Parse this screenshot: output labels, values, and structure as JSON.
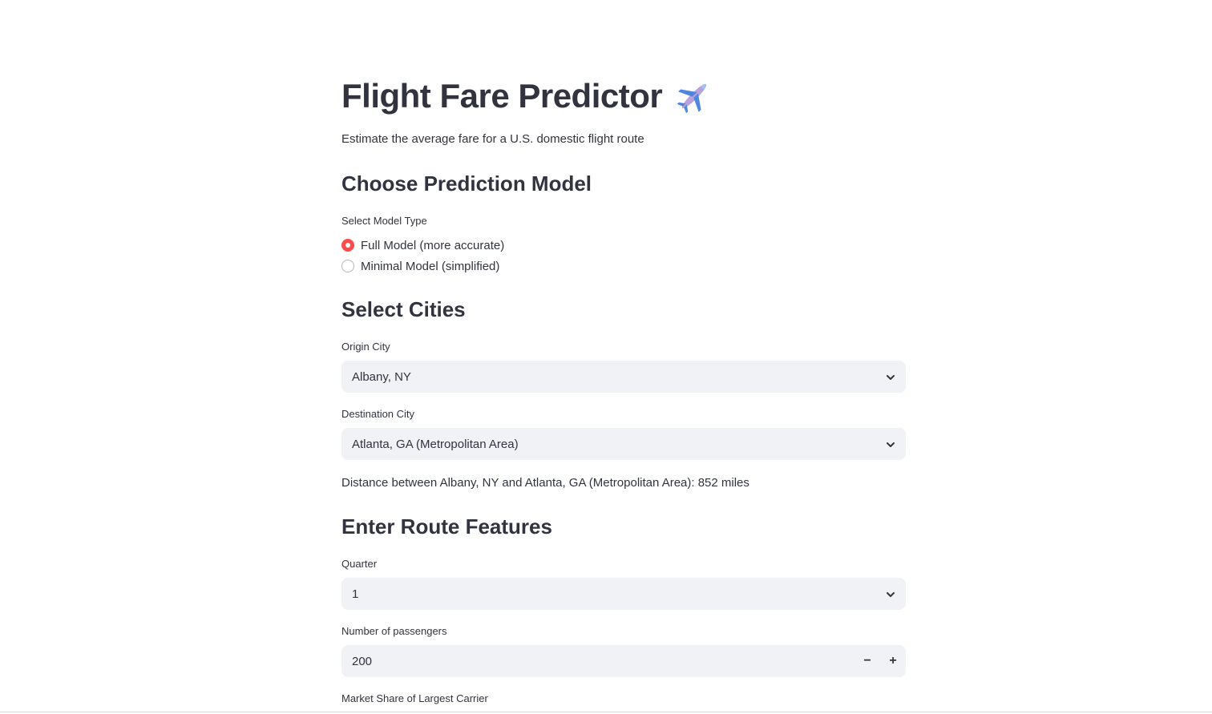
{
  "header": {
    "title": "Flight Fare Predictor",
    "subtitle": "Estimate the average fare for a U.S. domestic flight route"
  },
  "model_section": {
    "heading": "Choose Prediction Model",
    "radio_label": "Select Model Type",
    "options": [
      {
        "label": "Full Model (more accurate)",
        "selected": true
      },
      {
        "label": "Minimal Model (simplified)",
        "selected": false
      }
    ]
  },
  "cities_section": {
    "heading": "Select Cities",
    "origin_label": "Origin City",
    "origin_value": "Albany, NY",
    "destination_label": "Destination City",
    "destination_value": "Atlanta, GA (Metropolitan Area)",
    "distance_text": "Distance between Albany, NY and Atlanta, GA (Metropolitan Area): 852 miles"
  },
  "route_section": {
    "heading": "Enter Route Features",
    "quarter_label": "Quarter",
    "quarter_value": "1",
    "passengers_label": "Number of passengers",
    "passengers_value": "200",
    "decrement_symbol": "−",
    "increment_symbol": "+",
    "market_share_label": "Market Share of Largest Carrier"
  },
  "colors": {
    "accent": "#ff4b4b",
    "input_bg": "#f0f2f6",
    "text": "#31333f"
  },
  "icons": {
    "title_icon": "airplane-icon",
    "dropdown_icon": "chevron-down-icon"
  }
}
